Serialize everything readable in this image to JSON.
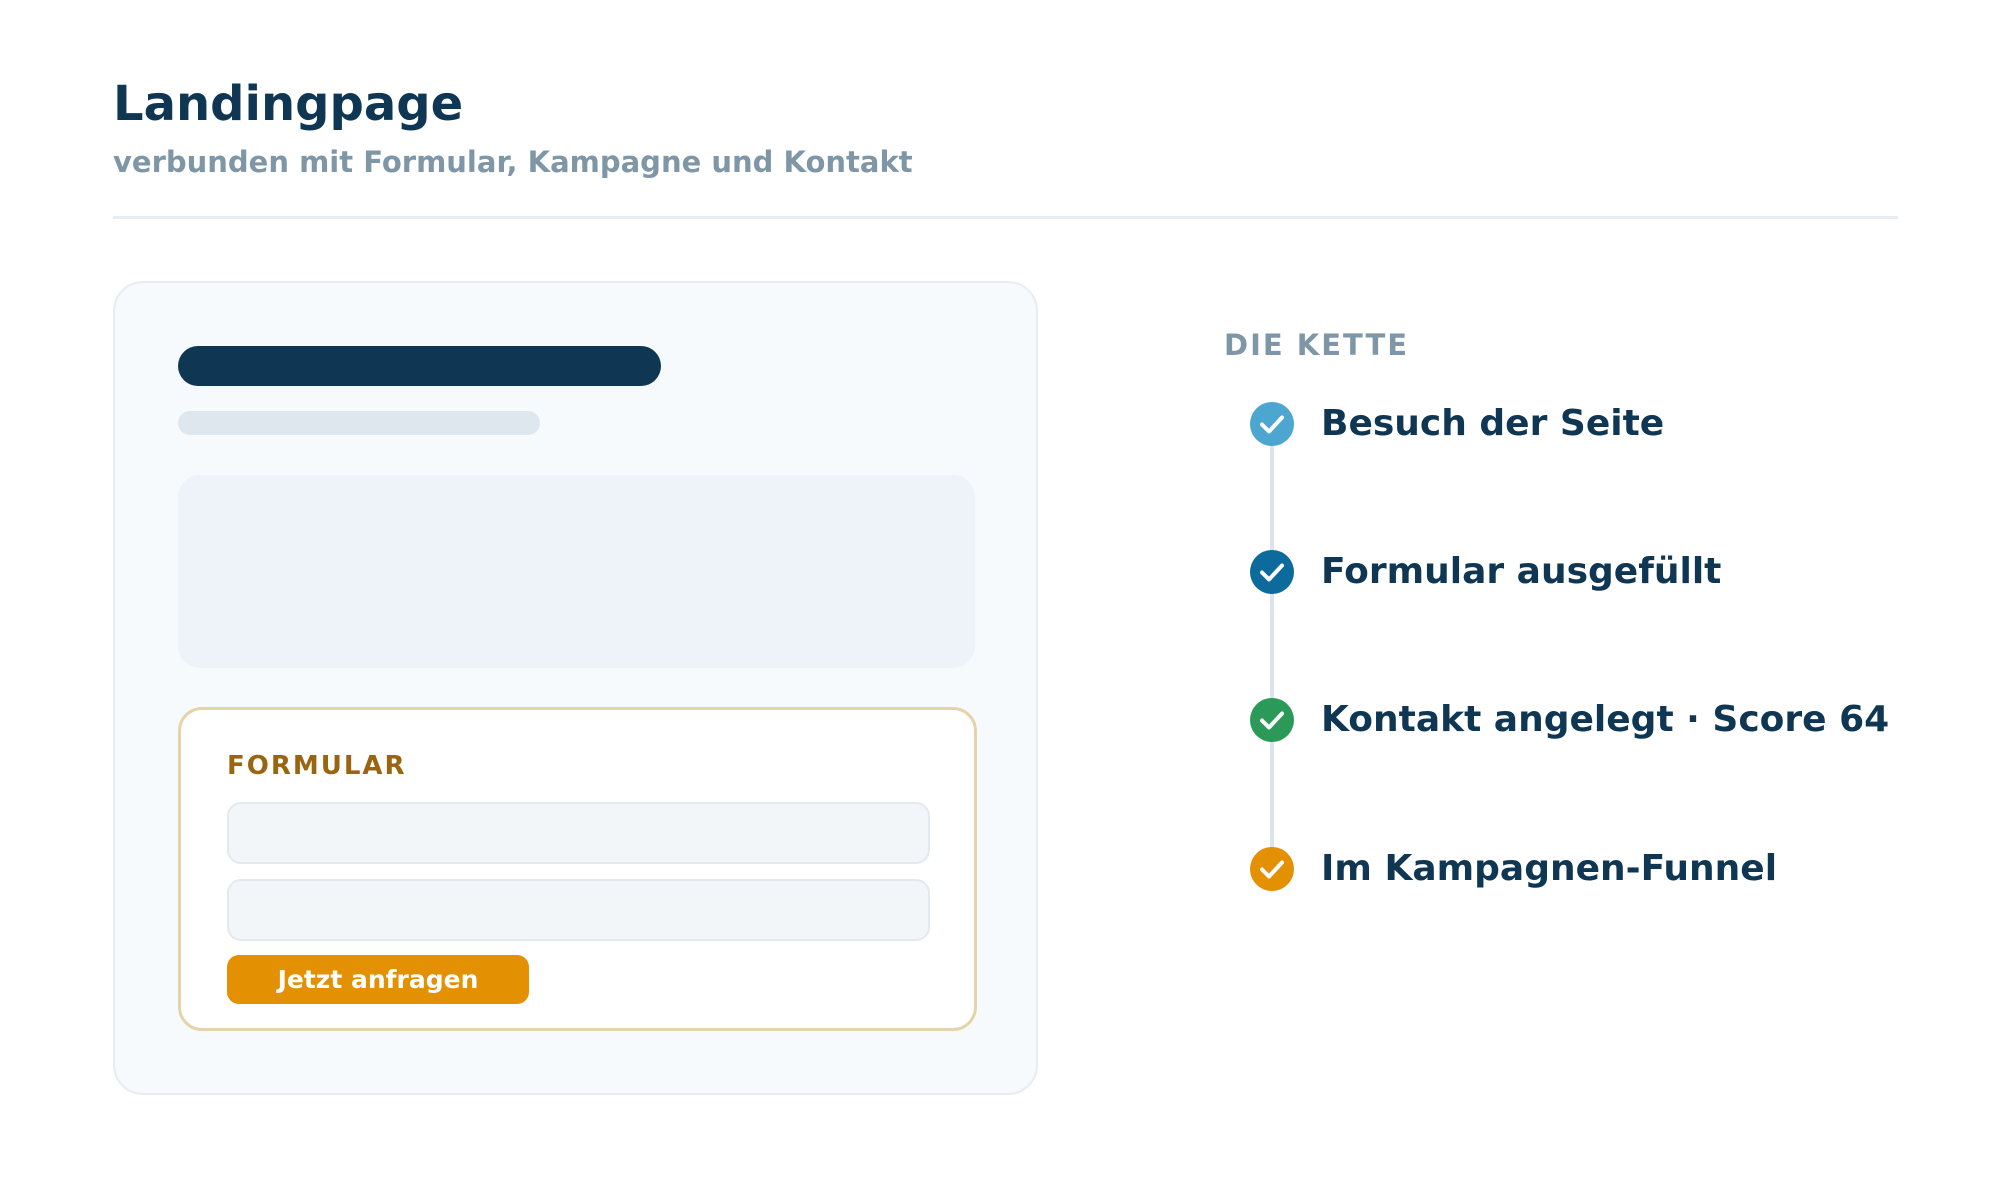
{
  "header": {
    "title": "Landingpage",
    "subtitle": "verbunden mit Formular, Kampagne und Kontakt"
  },
  "form": {
    "label": "FORMULAR",
    "button_label": "Jetzt anfragen",
    "button_color": "#e39003"
  },
  "chain": {
    "heading": "DIE KETTE",
    "steps": [
      {
        "label": "Besuch der Seite",
        "color": "#4ca6cf",
        "icon": "check-icon"
      },
      {
        "label": "Formular ausgefüllt",
        "color": "#0d6a9c",
        "icon": "check-icon"
      },
      {
        "label": "Kontakt angelegt · Score 64",
        "color": "#2b9a59",
        "icon": "check-icon"
      },
      {
        "label": "Im Kampagnen-Funnel",
        "color": "#e39003",
        "icon": "check-icon"
      }
    ]
  }
}
